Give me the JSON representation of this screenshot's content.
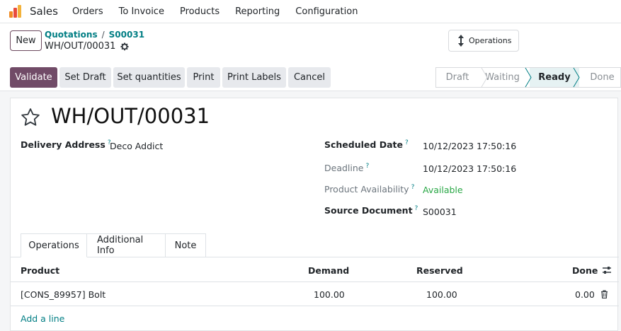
{
  "navbar": {
    "app_name": "Sales",
    "menu": [
      "Orders",
      "To Invoice",
      "Products",
      "Reporting",
      "Configuration"
    ]
  },
  "control_panel": {
    "new_label": "New",
    "breadcrumb": [
      "Quotations",
      "S00031"
    ],
    "breadcrumb_separator": "/",
    "record_name": "WH/OUT/00031",
    "operations_label": "Operations"
  },
  "actions": {
    "validate": "Validate",
    "set_draft": "Set Draft",
    "set_quantities": "Set quantities",
    "print": "Print",
    "print_labels": "Print Labels",
    "cancel": "Cancel"
  },
  "status": {
    "stages": [
      "Draft",
      "Waiting",
      "Ready",
      "Done"
    ],
    "current": "Ready"
  },
  "form": {
    "title": "WH/OUT/00031",
    "delivery_address_label": "Delivery Address",
    "delivery_address": "Deco Addict",
    "scheduled_date_label": "Scheduled Date",
    "scheduled_date": "10/12/2023 17:50:16",
    "deadline_label": "Deadline",
    "deadline": "10/12/2023 17:50:16",
    "availability_label": "Product Availability",
    "availability": "Available",
    "source_document_label": "Source Document",
    "source_document": "S00031",
    "help_mark": "?"
  },
  "tabs": [
    "Operations",
    "Additional Info",
    "Note"
  ],
  "table": {
    "columns": [
      "Product",
      "Demand",
      "Reserved",
      "Done"
    ],
    "rows": [
      {
        "product": "[CONS_89957] Bolt",
        "demand": "100.00",
        "reserved": "100.00",
        "done": "0.00"
      }
    ],
    "add_line": "Add a line"
  },
  "colors": {
    "primary": "#714b67",
    "link": "#017e84",
    "available": "#28a745",
    "active_stage_bg": "#e6f2f3"
  },
  "icons": {
    "app": "sales-app-icon",
    "gear": "gear-icon",
    "operations": "up-down-arrows-icon",
    "star": "star-outline-icon",
    "optional_columns": "sliders-icon",
    "delete": "trash-icon"
  }
}
